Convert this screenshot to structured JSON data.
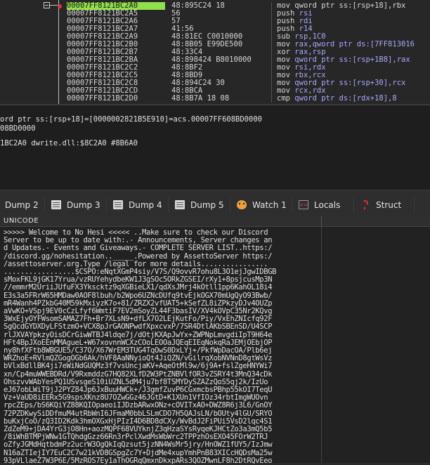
{
  "disassembly": {
    "top_partial": "48:895C24 18                  mov qword ptr ss:[rsp+18],rbx",
    "rows": [
      {
        "addr": "00007FF8121BC2A0",
        "bytes": "48:895C24 18",
        "op": "mov",
        "args": "qword ptr ss:[rsp+18],rbx",
        "selected": true
      },
      {
        "addr": "00007FF8121BC2A5",
        "bytes": "56",
        "op": "push",
        "args": "rsi",
        "selected": false
      },
      {
        "addr": "00007FF8121BC2A6",
        "bytes": "57",
        "op": "push",
        "args": "rdi",
        "selected": false
      },
      {
        "addr": "00007FF8121BC2A7",
        "bytes": "41:56",
        "op": "push",
        "args": "r14",
        "selected": false
      },
      {
        "addr": "00007FF8121BC2A9",
        "bytes": "48:81EC C0010000",
        "op": "sub",
        "args": "rsp,1C0",
        "selected": false
      },
      {
        "addr": "00007FF8121BC2B0",
        "bytes": "48:8B05 E99DE500",
        "op": "mov",
        "args": "rax,qword ptr ds:[7FF813016",
        "selected": false
      },
      {
        "addr": "00007FF8121BC2B7",
        "bytes": "48:33C4",
        "op": "xor",
        "args": "rax,rsp",
        "selected": false
      },
      {
        "addr": "00007FF8121BC2BA",
        "bytes": "48:898424 B8010000",
        "op": "mov",
        "args": "qword ptr ss:[rsp+1B8],rax",
        "selected": false
      },
      {
        "addr": "00007FF8121BC2C2",
        "bytes": "48:8BF2",
        "op": "mov",
        "args": "rsi,rdx",
        "selected": false
      },
      {
        "addr": "00007FF8121BC2C5",
        "bytes": "48:8BD9",
        "op": "mov",
        "args": "rbx,rcx",
        "selected": false
      },
      {
        "addr": "00007FF8121BC2C8",
        "bytes": "48:894C24 30",
        "op": "mov",
        "args": "qword ptr ss:[rsp+30],rcx",
        "selected": false
      },
      {
        "addr": "00007FF8121BC2CD",
        "bytes": "48:8BCA",
        "op": "mov",
        "args": "rcx,rdx",
        "selected": false
      },
      {
        "addr": "00007FF8121BC2D0",
        "bytes": "48:8B7A 18 08",
        "op": "cmp",
        "args": "qword ptr ds:[rdx+18],8",
        "selected": false
      }
    ]
  },
  "info": {
    "line1": "ord ptr ss:[rsp+18]=[0000002821B5E910]=acs.00007FF608BD0000",
    "line2": "08BD0000",
    "line3": "1BC2A0 dwrite.dll:$8C2A0 #8B6A0"
  },
  "tabs": [
    {
      "label": "Dump 2",
      "icon": "dump-icon",
      "active": false
    },
    {
      "label": "Dump 3",
      "icon": "dump-icon",
      "active": false
    },
    {
      "label": "Dump 4",
      "icon": "dump-icon",
      "active": false
    },
    {
      "label": "Dump 5",
      "icon": "dump-icon",
      "active": false
    },
    {
      "label": "Watch 1",
      "icon": "watch-icon",
      "active": false
    },
    {
      "label": "Locals",
      "icon": "locals-icon",
      "active": false
    },
    {
      "label": "Struct",
      "icon": "struct-icon",
      "active": false
    }
  ],
  "unicode": {
    "header": "UNICODE",
    "lines": [
      ">>>>> Welcome to No Hesi <<<<< ..Make sure to check our Discord",
      "Server to be up to date with:.- Announcements, Server changes an",
      "d Updates.- Events and Giveaways.- COMPLETE SERVER LIST..https:/",
      "/discord.gg/nohesitation.._____.Powered by AssettoServer https:/",
      "/assettoserver.org.Type /legal for more details................",
      ".................$CSPO:eNqtXGmP4siy/V7S/Q9ovvR7ohu8L3O1ejJgwIDBGB",
      "sMoxFKL9jGK17Yrua/vzRUYehydbeKW1J3gSOc5ORkZGSEI/rXy1+8psjcusMp3N",
      "//emmrM2UriiJUfuFX3Ykscktz9qXGBieLX1/qdXsJMrj4kOtll1pp6KahOL18i4",
      "E3s3a5FRrW65HMDaw0AOF8lbuh/b2Wpo6UZNcDUfq9tvEjkOGX70mUgQyO93Bwb/",
      "mR4Wanh4PZkbG40M59kMxiyzK7o+81/ZRZX2vfUAT5+kSefZL8iZPkzyDJv4OUZp",
      "aVwKO+VSpj9EV0cCzLfyf6WmtiF7EV2mSoyZL44F3basIV/XV4kOVpC35Nr2KQvg",
      "3WxEjyOYFWsomSAMAZ7Fh+Br7XLsN9+dfLX7O2LEjKutFo/Piy/VxEhZNIcfq92F",
      "SgQcdGYDXDyLFStzmO+VCX8pJrGAONPwdfXpxcvxP/7SR4DtlAKbSBEnSD/U4SCP",
      "rlJXVAYpkzyOisDCrGiwWTBJ4ldqe7j/dOtjKXApJwYx+ZWPNpLmvgdiIpT9H64e",
      "HFt4BpJXoEEnMMAgueL+W67xovnnWCXzCOoLEOOaJQEqEIEqNokqRaJEMjOEbjOP",
      "ny8hfXFtb8WBGUE5/C37O/X67WrEM3TUG4TqOwS0DxLYj+/PkfWpDacOA/Plb6ej",
      "WRZhoE+RVlmQZGogOGb6Ak/hVF8AaNNyioQt4JiQZN/vGilrqXobNVNnD8gtWsVz",
      "bVlxBdllBK4ji7eWiNdGUQMz3f7vsUncjaKV+AqeOtMl9w/6j9A+fslZgeHNYWi7",
      "xn/Cp4muWWEBDRd/V9RxmddzG7HQ82XLfD2W3PtZNBVlfOR3vZSRY4t3MnQ34cDk",
      "OhszvvWAbYesPQ1USvsgeS10iUZNL5dM4ju7bf8TSMYDySZAZzQoS5qj2k/IzUo",
      "eJ67obLWiT9jJ2PYZ84Jp6JxBuuHWCk+/J3gmfZuvP6CGxmcbsPBhp55kOI7TeqU",
      "Vz+VaUD8iEERx5G9spsXKnz8U7OZwGGz46JGtD+K1XUn1VfIOz34rbtImgWUOvn",
      "rpcZEps/bS6KQiYZ88KQIOpaeoiIJDzbARwxONz+cOVITxAO+DWZ8R6j3L6/GnOY",
      "72PZDKwySiDDfmuM4utRbWnI6JFmaM0bbLSLmCDO7H5QAJsLN/bOUty4lGU/SRYO",
      "buKxjCoO/zQ3ID2Kdk3hmOXGxHjPIzI4D6BD8dCXy/WvBdJ2FiPUi5VsD2lqc4S1",
      "ZdZeM9+jDA4YrG3jO8Hn+aozMQPF68VUYknjZ3qHzaSYsRyqeKJHCtZo3a3mQ5b5",
      "/8iWhBTMPjWNw1GTQhdgGzz66Rn3rPclXwdMsWbWrc2TPPzhOsEXO45FOrW2TRJ",
      "oZfyJGMdHqtbdmPz2ucrW3OgQkIqQzsut5jzNN4WsMr5jry/HnOWZ1fUY5/IzJmw",
      "N16aZTIejIY7EuC2C7w21kVD8GSpgZc7Y+DjdMe4xupYmhPnB83XICcHQDsMa25w",
      "93pVLlaeZ7W3P6E/5MzROS7Ey1aThOGRqQmxnDkxpARs3QOZMwnLF8h2DtRQvEeo"
    ]
  }
}
